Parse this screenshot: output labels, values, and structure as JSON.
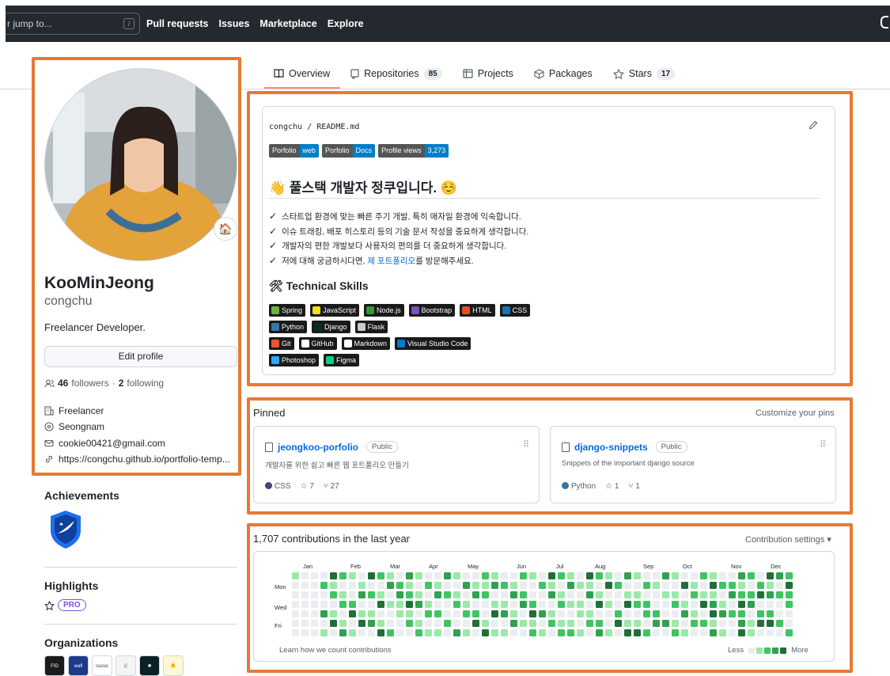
{
  "header": {
    "search_placeholder": "r jump to...",
    "slash_key": "/",
    "nav": [
      "Pull requests",
      "Issues",
      "Marketplace",
      "Explore"
    ]
  },
  "tabs": [
    {
      "label": "Overview",
      "icon": "book-icon",
      "count": ""
    },
    {
      "label": "Repositories",
      "icon": "repo-icon",
      "count": "85"
    },
    {
      "label": "Projects",
      "icon": "project-icon",
      "count": ""
    },
    {
      "label": "Packages",
      "icon": "package-icon",
      "count": ""
    },
    {
      "label": "Stars",
      "icon": "star-icon",
      "count": "17"
    }
  ],
  "profile": {
    "status_emoji": "🏠",
    "fullname": "KooMinJeong",
    "username": "congchu",
    "bio": "Freelancer Developer.",
    "edit_label": "Edit profile",
    "followers_count": "46",
    "followers_label": "followers",
    "sep": "·",
    "following_count": "2",
    "following_label": "following",
    "company": "Freelancer",
    "location": "Seongnam",
    "email": "cookie00421@gmail.com",
    "website": "https://congchu.github.io/portfolio-temp..."
  },
  "sidebar": {
    "achievements_title": "Achievements",
    "highlights_title": "Highlights",
    "pro_label": "PRO",
    "organizations_title": "Organizations",
    "orgs": [
      {
        "label": "FID",
        "color": "#1b1b1b"
      },
      {
        "label": "wafl",
        "color": "#1e3a8a"
      },
      {
        "label": "cucus",
        "color": "#ffffff"
      },
      {
        "label": "🐰",
        "color": "#f5f5f5"
      },
      {
        "label": "✺",
        "color": "#0b1f26"
      },
      {
        "label": "🐥",
        "color": "#fff7d6"
      }
    ]
  },
  "readme": {
    "path_user": "congchu",
    "path_sep": "/",
    "path_file": "README.md",
    "shields": [
      {
        "left": "Porfolio",
        "right": "web"
      },
      {
        "left": "Porfolio",
        "right": "Docs"
      },
      {
        "left": "Profile views",
        "right": "3,273"
      }
    ],
    "heading": "👋 풀스택 개발자 정쿠입니다. ☺️",
    "checks": [
      "스타트업 환경에 맞는 빠른 주기 개발, 특히 애자일 환경에 익숙합니다.",
      "이슈 트래킹, 배포 히스토리 등의 기술 문서 작성을 중요하게 생각합니다.",
      "개발자의 편한 개발보다 사용자의 편의를 더 중요하게 생각합니다."
    ],
    "check4_pre": "저에 대해 궁금하시다면,",
    "check4_link": "제 포트폴리오",
    "check4_post": "를 방문해주세요.",
    "skills_heading": "🛠 Technical Skills",
    "skill_rows": [
      [
        {
          "label": "Spring",
          "color": "#6db33f"
        },
        {
          "label": "JavaScript",
          "color": "#f7df1e"
        },
        {
          "label": "Node.js",
          "color": "#339933"
        },
        {
          "label": "Bootstrap",
          "color": "#7952b3"
        },
        {
          "label": "HTML",
          "color": "#e34f26"
        },
        {
          "label": "CSS",
          "color": "#1572b6"
        }
      ],
      [
        {
          "label": "Python",
          "color": "#3776ab"
        },
        {
          "label": "Django",
          "color": "#092e20"
        },
        {
          "label": "Flask",
          "color": "#cccccc"
        }
      ],
      [
        {
          "label": "Git",
          "color": "#f05032"
        },
        {
          "label": "GitHub",
          "color": "#ffffff"
        },
        {
          "label": "Markdown",
          "color": "#ffffff"
        },
        {
          "label": "Visual Studio Code",
          "color": "#007acc"
        }
      ],
      [
        {
          "label": "Photoshop",
          "color": "#31a8ff"
        },
        {
          "label": "Figma",
          "color": "#0acf83"
        }
      ]
    ]
  },
  "pinned": {
    "title": "Pinned",
    "customize": "Customize your pins",
    "repos": [
      {
        "name": "jeongkoo-porfolio",
        "visibility": "Public",
        "desc": "개발자를 위한 쉽고 빠른 웹 포트폴리오 만들기",
        "lang": "CSS",
        "lang_color": "#563d7c",
        "stars": "7",
        "forks": "27"
      },
      {
        "name": "django-snippets",
        "visibility": "Public",
        "desc": "Snippets of the important django source",
        "lang": "Python",
        "lang_color": "#3572A5",
        "stars": "1",
        "forks": "1"
      }
    ]
  },
  "contributions": {
    "title": "1,707 contributions in the last year",
    "settings": "Contribution settings ▾",
    "months": [
      "Jan",
      "Feb",
      "Mar",
      "Apr",
      "May",
      "Jun",
      "Jul",
      "Aug",
      "Sep",
      "Oct",
      "Nov",
      "Dec"
    ],
    "days": [
      "Mon",
      "Wed",
      "Fri"
    ],
    "learn": "Learn how we count contributions",
    "less": "Less",
    "more": "More",
    "colors": [
      "#ebedf0",
      "#9be9a8",
      "#40c463",
      "#30a14e",
      "#216e39"
    ]
  }
}
